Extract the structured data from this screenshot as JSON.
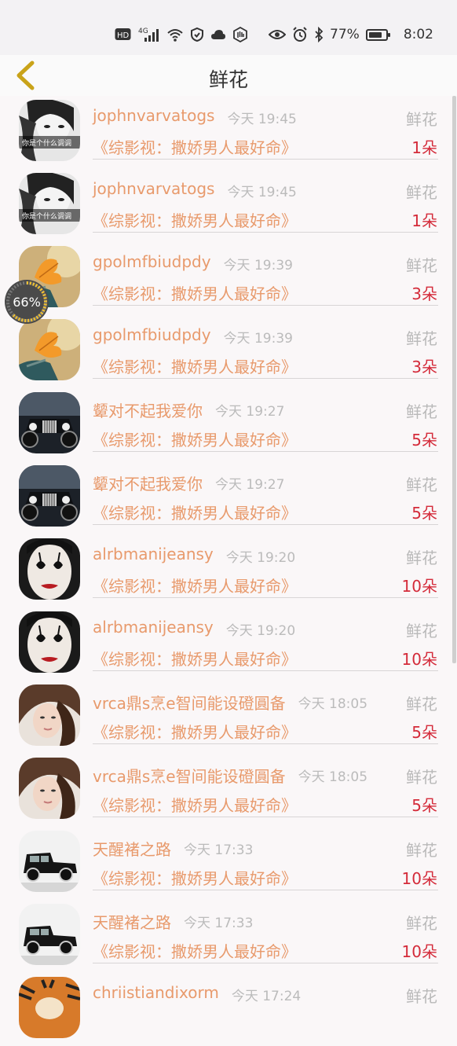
{
  "status_bar": {
    "hd": "HD",
    "network": "4G",
    "battery": "77%",
    "time": "8:02"
  },
  "header": {
    "title": "鲜花"
  },
  "floating_widget": {
    "progress_text": "66%",
    "progress": 0.66
  },
  "records": [
    {
      "name": "jophnvarvatogs",
      "time": "今天 19:45",
      "label": "鲜花",
      "book": "《综影视：撒娇男人最好命》",
      "count": "1朵",
      "avatar": "bw-girl"
    },
    {
      "name": "jophnvarvatogs",
      "time": "今天 19:45",
      "label": "鲜花",
      "book": "《综影视：撒娇男人最好命》",
      "count": "1朵",
      "avatar": "bw-girl"
    },
    {
      "name": "gpolmfbiudpdy",
      "time": "今天 19:39",
      "label": "鲜花",
      "book": "《综影视：撒娇男人最好命》",
      "count": "3朵",
      "avatar": "leaf"
    },
    {
      "name": "gpolmfbiudpdy",
      "time": "今天 19:39",
      "label": "鲜花",
      "book": "《综影视：撒娇男人最好命》",
      "count": "3朵",
      "avatar": "leaf"
    },
    {
      "name": "颦对不起我爱你",
      "time": "今天 19:27",
      "label": "鲜花",
      "book": "《综影视：撒娇男人最好命》",
      "count": "5朵",
      "avatar": "car"
    },
    {
      "name": "颦对不起我爱你",
      "time": "今天 19:27",
      "label": "鲜花",
      "book": "《综影视：撒娇男人最好命》",
      "count": "5朵",
      "avatar": "car"
    },
    {
      "name": "alrbmanijeansy",
      "time": "今天 19:20",
      "label": "鲜花",
      "book": "《综影视：撒娇男人最好命》",
      "count": "10朵",
      "avatar": "clown"
    },
    {
      "name": "alrbmanijeansy",
      "time": "今天 19:20",
      "label": "鲜花",
      "book": "《综影视：撒娇男人最好命》",
      "count": "10朵",
      "avatar": "clown"
    },
    {
      "name": "vrca鼎s烹e智间能设磴圓备",
      "time": "今天 18:05",
      "label": "鲜花",
      "book": "《综影视：撒娇男人最好命》",
      "count": "5朵",
      "avatar": "woman"
    },
    {
      "name": "vrca鼎s烹e智间能设磴圓备",
      "time": "今天 18:05",
      "label": "鲜花",
      "book": "《综影视：撒娇男人最好命》",
      "count": "5朵",
      "avatar": "woman"
    },
    {
      "name": "天醒褚之路",
      "time": "今天 17:33",
      "label": "鲜花",
      "book": "《综影视：撒娇男人最好命》",
      "count": "10朵",
      "avatar": "vintage-car"
    },
    {
      "name": "天醒褚之路",
      "time": "今天 17:33",
      "label": "鲜花",
      "book": "《综影视：撒娇男人最好命》",
      "count": "10朵",
      "avatar": "vintage-car"
    },
    {
      "name": "chriistiandixorm",
      "time": "今天 17:24",
      "label": "鲜花",
      "book": "",
      "count": "",
      "avatar": "tiger"
    }
  ],
  "avatar_caption": "你是个什么调调",
  "colors": {
    "name": "#e89a6c",
    "count": "#d42b3a",
    "muted": "#bbbbbb",
    "back_arrow": "#c9a319"
  }
}
